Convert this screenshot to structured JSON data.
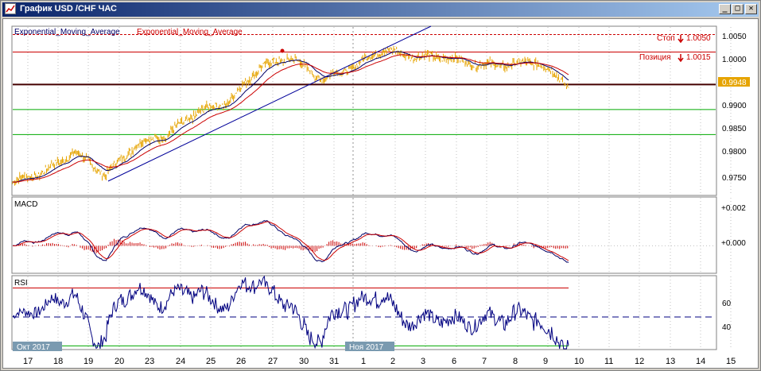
{
  "window": {
    "title": "График USD /CHF ЧАС",
    "buttons": {
      "minimize": "_",
      "maximize": "□",
      "close": "✕"
    }
  },
  "colors": {
    "price": "#e6a400",
    "ema_fast": "#000066",
    "ema_slow": "#cc0000",
    "trendline": "#000099",
    "level_red": "#cc0000",
    "level_dark": "#440000",
    "level_green": "#00aa00",
    "rsi": "#000080",
    "current_price_box": "#e6a400"
  },
  "main_panel": {
    "indicator_labels": [
      "Exponential_Moving_Average",
      "Exponential_Moving_Average"
    ],
    "y_axis": {
      "ticks": [
        "1.0050",
        "1.0000",
        "0.9950",
        "0.9900",
        "0.9850",
        "0.9800",
        "0.9750"
      ]
    },
    "current_price": "0.9948",
    "orders": [
      {
        "label": "Стоп",
        "price": "1.0050"
      },
      {
        "label": "Позиция",
        "price": "1.0015"
      }
    ],
    "horizontal_levels": [
      1.005,
      1.0015,
      0.995,
      0.99,
      0.985
    ]
  },
  "macd_panel": {
    "title": "MACD",
    "ticks": [
      "+0.002",
      "+0.000"
    ]
  },
  "rsi_panel": {
    "title": "RSI",
    "ticks": [
      "60",
      "40"
    ]
  },
  "x_axis": {
    "month_labels": [
      "Окт 2017",
      "Ноя 2017"
    ],
    "day_labels": [
      "17",
      "18",
      "19",
      "20",
      "23",
      "24",
      "25",
      "26",
      "27",
      "30",
      "31",
      "1",
      "2",
      "3",
      "6",
      "7",
      "8",
      "9",
      "10",
      "11",
      "12",
      "13",
      "14",
      "15"
    ]
  },
  "chart_data": {
    "type": "line",
    "title": "График USD /CHF ЧАС",
    "series_names": [
      "Exponential_Moving_Average",
      "Exponential_Moving_Average"
    ],
    "x": [
      "17",
      "18",
      "19",
      "20",
      "23",
      "24",
      "25",
      "26",
      "27",
      "30",
      "31",
      "1",
      "2",
      "3",
      "6",
      "7",
      "8",
      "9",
      "10"
    ],
    "price_series": [
      0.9755,
      0.9775,
      0.9815,
      0.977,
      0.983,
      0.985,
      0.9895,
      0.9915,
      0.9985,
      1.0005,
      0.996,
      0.9985,
      1.002,
      1.0005,
      1.0005,
      0.999,
      0.999,
      0.9995,
      0.9948
    ],
    "ylim": [
      0.973,
      1.0065
    ],
    "macd_ylim": [
      -0.0015,
      0.0027
    ],
    "rsi_ylim": [
      28,
      78
    ],
    "rsi_levels": [
      70,
      30,
      50
    ]
  }
}
